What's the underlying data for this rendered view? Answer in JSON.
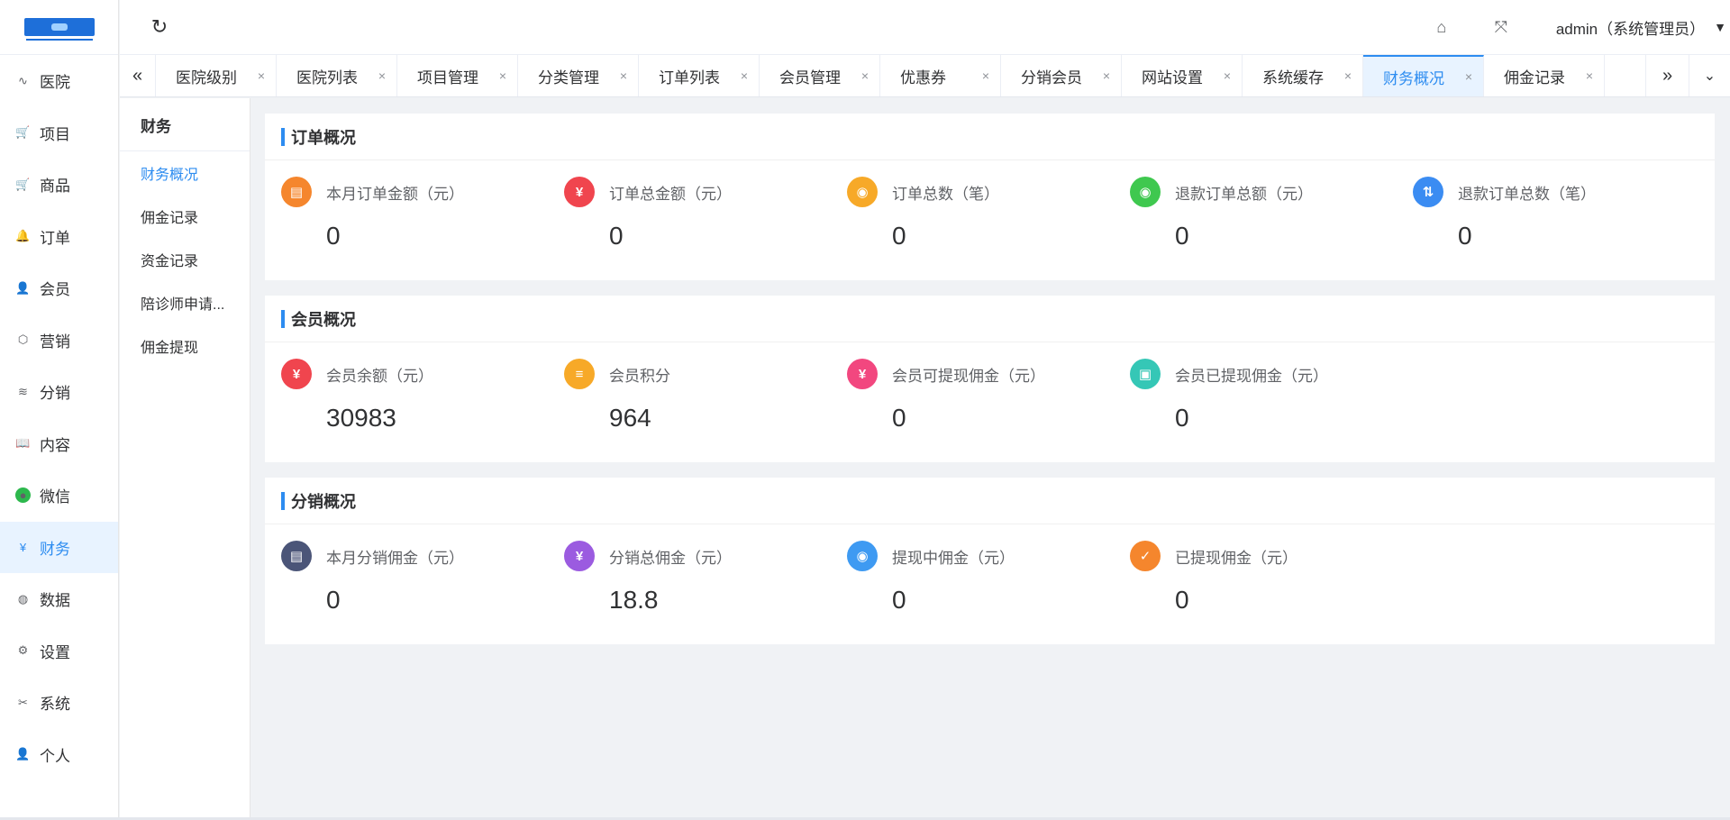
{
  "header": {
    "user_label": "admin（系统管理员）"
  },
  "sidebar": {
    "items": [
      {
        "label": "医院",
        "icon": "pulse-icon",
        "glyph": "∿"
      },
      {
        "label": "项目",
        "icon": "cart-icon",
        "glyph": "🛒"
      },
      {
        "label": "商品",
        "icon": "cart-icon",
        "glyph": "🛒"
      },
      {
        "label": "订单",
        "icon": "bell-icon",
        "glyph": "🔔"
      },
      {
        "label": "会员",
        "icon": "user-icon",
        "glyph": "👤"
      },
      {
        "label": "营销",
        "icon": "box-icon",
        "glyph": "⬡"
      },
      {
        "label": "分销",
        "icon": "layers-icon",
        "glyph": "≋"
      },
      {
        "label": "内容",
        "icon": "book-icon",
        "glyph": "📖"
      },
      {
        "label": "微信",
        "icon": "wechat-icon",
        "glyph": "●"
      },
      {
        "label": "财务",
        "icon": "yen-icon",
        "glyph": "¥"
      },
      {
        "label": "数据",
        "icon": "globe-icon",
        "glyph": "◍"
      },
      {
        "label": "设置",
        "icon": "gear-icon",
        "glyph": "⚙"
      },
      {
        "label": "系统",
        "icon": "tools-icon",
        "glyph": "✂"
      },
      {
        "label": "个人",
        "icon": "person-icon",
        "glyph": "👤"
      }
    ]
  },
  "tabs": [
    {
      "label": "医院级别"
    },
    {
      "label": "医院列表"
    },
    {
      "label": "项目管理"
    },
    {
      "label": "分类管理"
    },
    {
      "label": "订单列表"
    },
    {
      "label": "会员管理"
    },
    {
      "label": "优惠券"
    },
    {
      "label": "分销会员"
    },
    {
      "label": "网站设置"
    },
    {
      "label": "系统缓存"
    },
    {
      "label": "财务概况"
    },
    {
      "label": "佣金记录"
    }
  ],
  "subnav": {
    "title": "财务",
    "items": [
      {
        "label": "财务概况"
      },
      {
        "label": "佣金记录"
      },
      {
        "label": "资金记录"
      },
      {
        "label": "陪诊师申请..."
      },
      {
        "label": "佣金提现"
      }
    ]
  },
  "sections": {
    "order": {
      "title": "订单概况",
      "stats": [
        {
          "label": "本月订单金额（元）",
          "value": "0",
          "color": "#f5862d",
          "glyph": "▤"
        },
        {
          "label": "订单总金额（元）",
          "value": "0",
          "color": "#f0454e",
          "glyph": "¥"
        },
        {
          "label": "订单总数（笔）",
          "value": "0",
          "color": "#f7a928",
          "glyph": "◉"
        },
        {
          "label": "退款订单总额（元）",
          "value": "0",
          "color": "#3fc84f",
          "glyph": "◉"
        },
        {
          "label": "退款订单总数（笔）",
          "value": "0",
          "color": "#3b8cf2",
          "glyph": "⇅"
        }
      ]
    },
    "member": {
      "title": "会员概况",
      "stats": [
        {
          "label": "会员余额（元）",
          "value": "30983",
          "color": "#f0454e",
          "glyph": "¥"
        },
        {
          "label": "会员积分",
          "value": "964",
          "color": "#f7a928",
          "glyph": "≡"
        },
        {
          "label": "会员可提现佣金（元）",
          "value": "0",
          "color": "#f2477f",
          "glyph": "¥"
        },
        {
          "label": "会员已提现佣金（元）",
          "value": "0",
          "color": "#35c7b6",
          "glyph": "▣"
        }
      ]
    },
    "distribution": {
      "title": "分销概况",
      "stats": [
        {
          "label": "本月分销佣金（元）",
          "value": "0",
          "color": "#4b5578",
          "glyph": "▤"
        },
        {
          "label": "分销总佣金（元）",
          "value": "18.8",
          "color": "#9b5be0",
          "glyph": "¥"
        },
        {
          "label": "提现中佣金（元）",
          "value": "0",
          "color": "#3e9af2",
          "glyph": "◉"
        },
        {
          "label": "已提现佣金（元）",
          "value": "0",
          "color": "#f5862d",
          "glyph": "✓"
        }
      ]
    }
  }
}
